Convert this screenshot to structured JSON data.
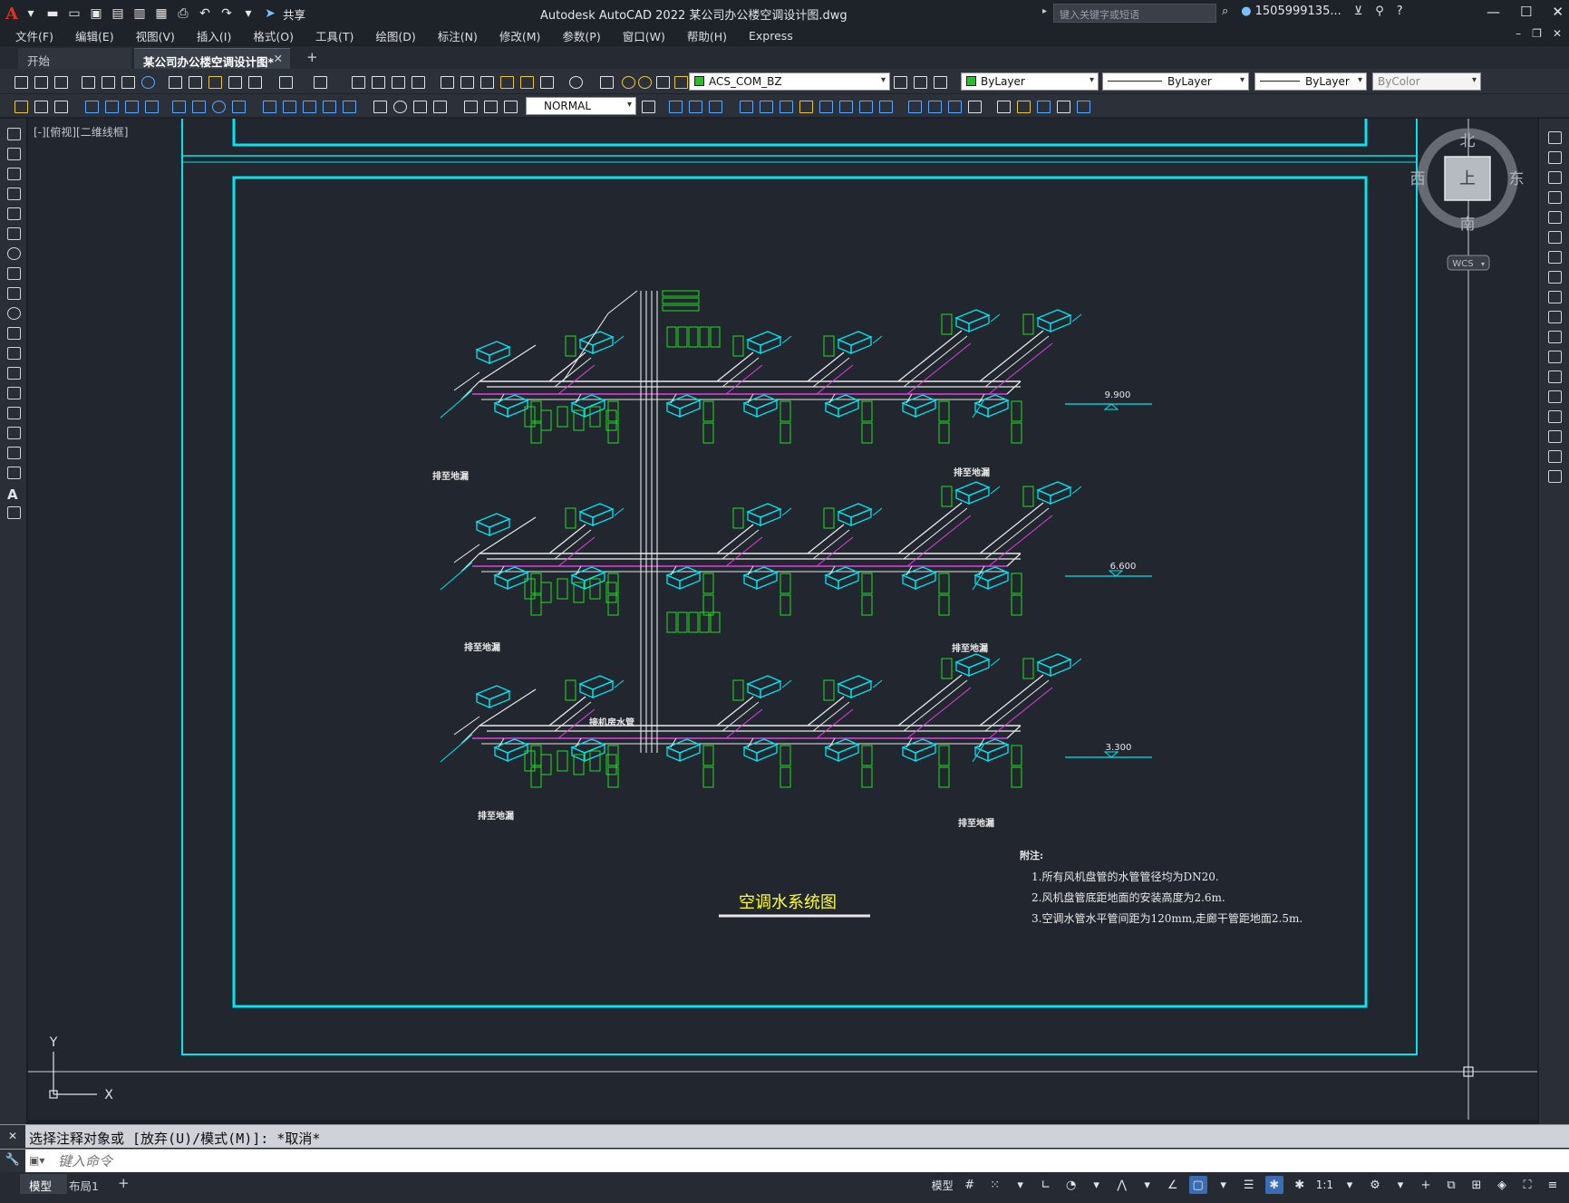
{
  "app": {
    "title": "Autodesk AutoCAD 2022    某公司办公楼空调设计图.dwg",
    "search_placeholder": "键入关键字或短语",
    "user": "1505999135...",
    "logo": "A"
  },
  "menu": [
    "文件(F)",
    "编辑(E)",
    "视图(V)",
    "插入(I)",
    "格式(O)",
    "工具(T)",
    "绘图(D)",
    "标注(N)",
    "修改(M)",
    "参数(P)",
    "窗口(W)",
    "帮助(H)",
    "Express"
  ],
  "quick_access": {
    "share_label": "共享"
  },
  "tabs": {
    "start": "开始",
    "document": "某公司办公楼空调设计图*",
    "add": "+"
  },
  "layer_combo": {
    "value": "ACS_COM_BZ",
    "color": "#1fc51f"
  },
  "color_combo": {
    "value": "ByLayer"
  },
  "linetype_combo": {
    "value": "ByLayer"
  },
  "lineweight_combo": {
    "value": "ByLayer"
  },
  "plotstyle_combo": {
    "value": "ByColor"
  },
  "textstyle_combo": {
    "value": "NORMAL"
  },
  "viewport_label": "[-][俯视][二维线框]",
  "viewcube": {
    "north": "北",
    "south": "南",
    "east": "东",
    "west": "西",
    "top": "上",
    "wcs": "WCS"
  },
  "drawing": {
    "title": "空调水系统图",
    "levels": [
      "9.900",
      "6.600",
      "3.300"
    ],
    "notes_heading": "附注:",
    "notes": [
      "1.所有风机盘管的水管管径均为DN20.",
      "2.风机盘管底距地面的安装高度为2.6m.",
      "3.空调水管水平管间距为120mm,走廊干管距地面2.5m."
    ],
    "drain_label": "排至地漏",
    "riser_label": "接机房水管",
    "colors": {
      "frame": "#00e5ee",
      "pipe": "#e8e8e8",
      "annotation": "#22dd22",
      "return_pipe": "#e040e0",
      "title": "#ffff33"
    }
  },
  "ucs": {
    "x": "X",
    "y": "Y"
  },
  "command": {
    "history": "选择注释对象或 [放弃(U)/模式(M)]: *取消*",
    "placeholder": "键入命令"
  },
  "layout_tabs": {
    "model": "模型",
    "layout1": "布局1",
    "add": "+"
  },
  "status": {
    "model_label": "模型",
    "scale": "1:1"
  }
}
